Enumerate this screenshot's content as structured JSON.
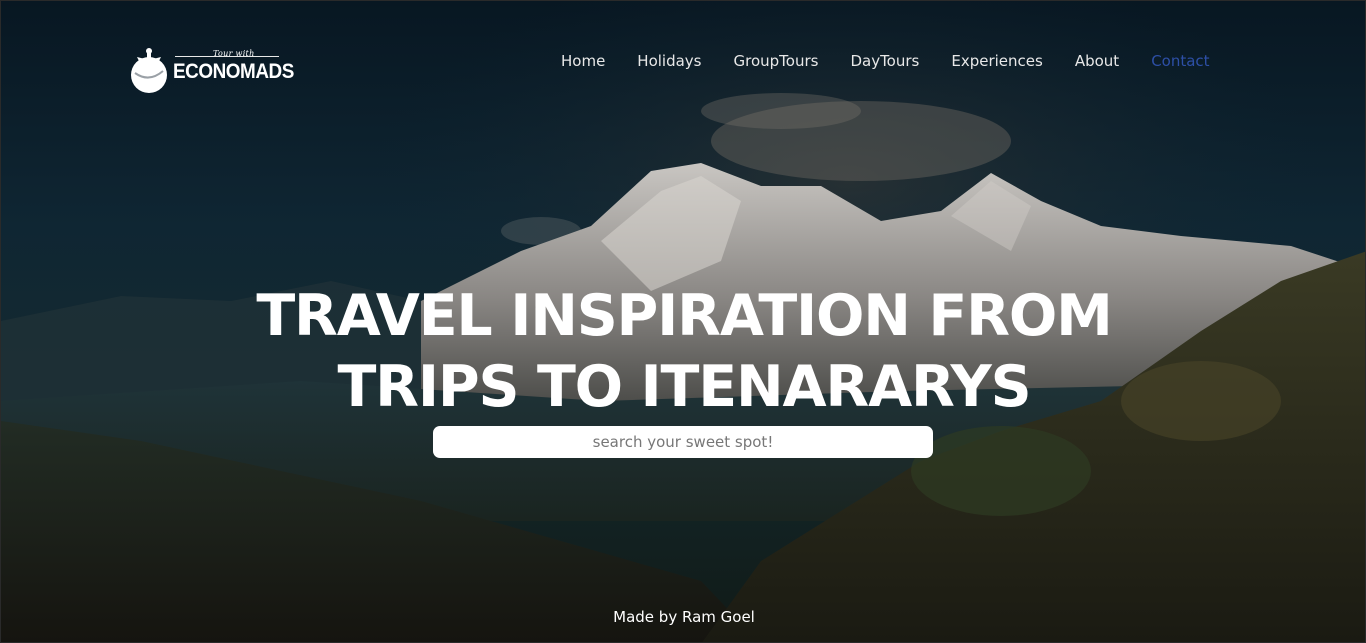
{
  "brand": {
    "tagline": "Tour with",
    "name": "ECONOMADS"
  },
  "nav": {
    "items": [
      {
        "label": "Home"
      },
      {
        "label": "Holidays"
      },
      {
        "label": "GroupTours"
      },
      {
        "label": "DayTours"
      },
      {
        "label": "Experiences"
      },
      {
        "label": "About"
      },
      {
        "label": "Contact"
      }
    ],
    "active_color": "#2d4fa6"
  },
  "hero": {
    "line1": "TRAVEL INSPIRATION FROM",
    "line2": "TRIPS TO ITENARARYS",
    "search_placeholder": "search your sweet spot!"
  },
  "footer": {
    "text": "Made by Ram Goel"
  }
}
